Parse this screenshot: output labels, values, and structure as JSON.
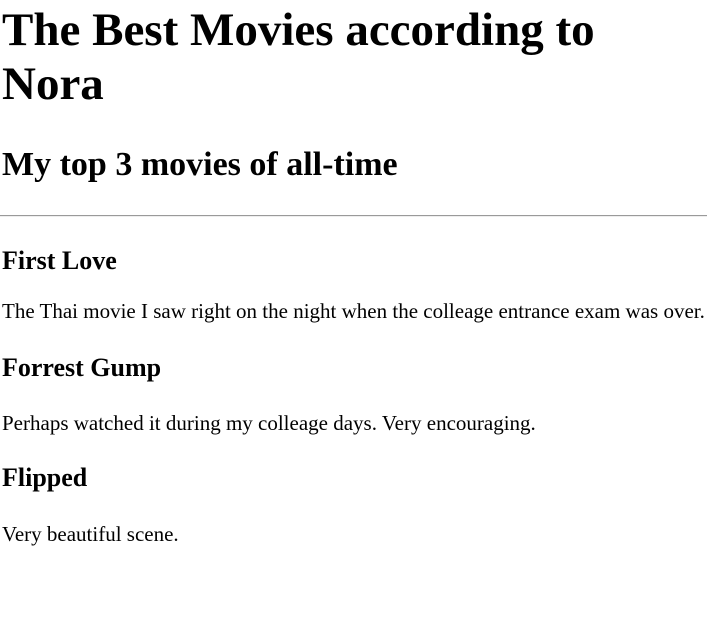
{
  "title": "The Best Movies according to Nora",
  "subtitle": "My top 3 movies of all-time",
  "movies": [
    {
      "name": "First Love",
      "description": "The Thai movie I saw right on the night when the colleage entrance exam was over."
    },
    {
      "name": "Forrest Gump",
      "description": "Perhaps watched it during my colleage days. Very encouraging."
    },
    {
      "name": "Flipped",
      "description": "Very beautiful scene."
    }
  ]
}
